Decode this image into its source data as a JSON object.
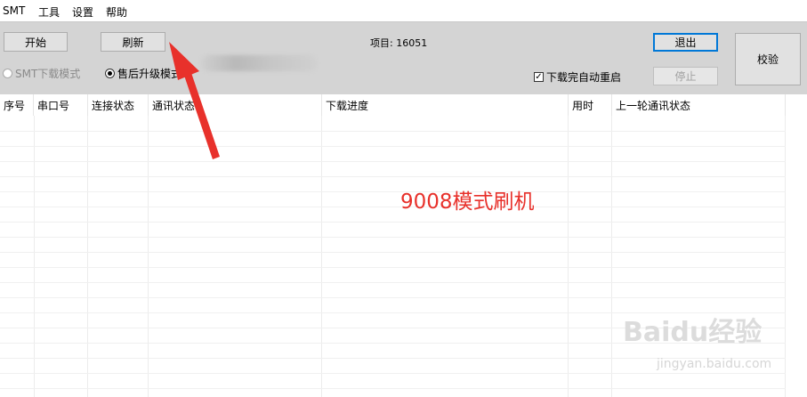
{
  "menu": [
    "SMT",
    "工具",
    "设置",
    "帮助"
  ],
  "toolbar": {
    "start_label": "开始",
    "refresh_label": "刷新",
    "project_label": "项目: 16051",
    "exit_label": "退出",
    "stop_label": "停止",
    "verify_label": "校验",
    "mode_smt_label": "SMT下载模式",
    "mode_after_sale_label": "售后升级模式",
    "auto_restart_label": "下载完自动重启"
  },
  "table": {
    "columns": [
      "序号",
      "串口号",
      "连接状态",
      "通讯状态",
      "下载进度",
      "用时",
      "上一轮通讯状态"
    ]
  },
  "annotation": {
    "text": "9008模式刷机",
    "color": "#e8312b"
  },
  "watermark": {
    "logo": "Baidu经验",
    "url": "jingyan.baidu.com"
  }
}
